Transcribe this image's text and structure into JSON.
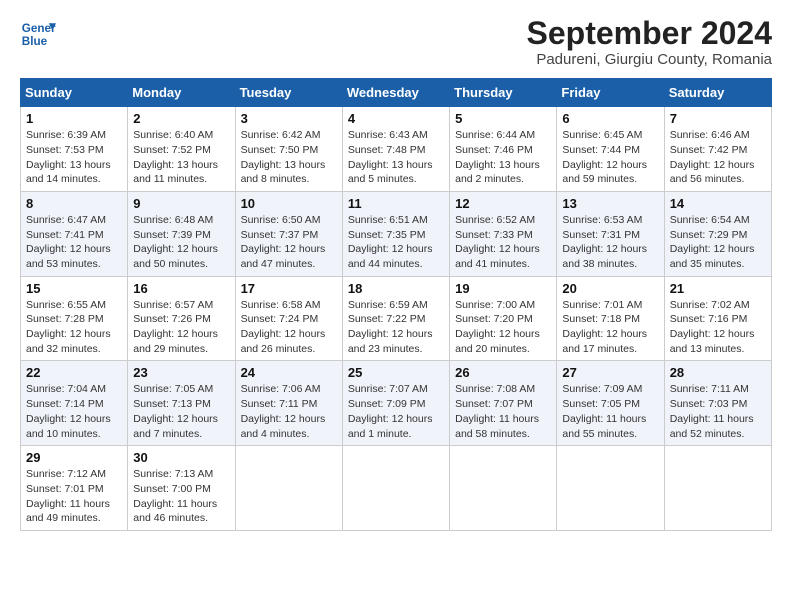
{
  "header": {
    "logo_line1": "General",
    "logo_line2": "Blue",
    "main_title": "September 2024",
    "subtitle": "Padureni, Giurgiu County, Romania"
  },
  "weekdays": [
    "Sunday",
    "Monday",
    "Tuesday",
    "Wednesday",
    "Thursday",
    "Friday",
    "Saturday"
  ],
  "weeks": [
    [
      {
        "day": "1",
        "sunrise": "6:39 AM",
        "sunset": "7:53 PM",
        "daylight": "13 hours and 14 minutes."
      },
      {
        "day": "2",
        "sunrise": "6:40 AM",
        "sunset": "7:52 PM",
        "daylight": "13 hours and 11 minutes."
      },
      {
        "day": "3",
        "sunrise": "6:42 AM",
        "sunset": "7:50 PM",
        "daylight": "13 hours and 8 minutes."
      },
      {
        "day": "4",
        "sunrise": "6:43 AM",
        "sunset": "7:48 PM",
        "daylight": "13 hours and 5 minutes."
      },
      {
        "day": "5",
        "sunrise": "6:44 AM",
        "sunset": "7:46 PM",
        "daylight": "13 hours and 2 minutes."
      },
      {
        "day": "6",
        "sunrise": "6:45 AM",
        "sunset": "7:44 PM",
        "daylight": "12 hours and 59 minutes."
      },
      {
        "day": "7",
        "sunrise": "6:46 AM",
        "sunset": "7:42 PM",
        "daylight": "12 hours and 56 minutes."
      }
    ],
    [
      {
        "day": "8",
        "sunrise": "6:47 AM",
        "sunset": "7:41 PM",
        "daylight": "12 hours and 53 minutes."
      },
      {
        "day": "9",
        "sunrise": "6:48 AM",
        "sunset": "7:39 PM",
        "daylight": "12 hours and 50 minutes."
      },
      {
        "day": "10",
        "sunrise": "6:50 AM",
        "sunset": "7:37 PM",
        "daylight": "12 hours and 47 minutes."
      },
      {
        "day": "11",
        "sunrise": "6:51 AM",
        "sunset": "7:35 PM",
        "daylight": "12 hours and 44 minutes."
      },
      {
        "day": "12",
        "sunrise": "6:52 AM",
        "sunset": "7:33 PM",
        "daylight": "12 hours and 41 minutes."
      },
      {
        "day": "13",
        "sunrise": "6:53 AM",
        "sunset": "7:31 PM",
        "daylight": "12 hours and 38 minutes."
      },
      {
        "day": "14",
        "sunrise": "6:54 AM",
        "sunset": "7:29 PM",
        "daylight": "12 hours and 35 minutes."
      }
    ],
    [
      {
        "day": "15",
        "sunrise": "6:55 AM",
        "sunset": "7:28 PM",
        "daylight": "12 hours and 32 minutes."
      },
      {
        "day": "16",
        "sunrise": "6:57 AM",
        "sunset": "7:26 PM",
        "daylight": "12 hours and 29 minutes."
      },
      {
        "day": "17",
        "sunrise": "6:58 AM",
        "sunset": "7:24 PM",
        "daylight": "12 hours and 26 minutes."
      },
      {
        "day": "18",
        "sunrise": "6:59 AM",
        "sunset": "7:22 PM",
        "daylight": "12 hours and 23 minutes."
      },
      {
        "day": "19",
        "sunrise": "7:00 AM",
        "sunset": "7:20 PM",
        "daylight": "12 hours and 20 minutes."
      },
      {
        "day": "20",
        "sunrise": "7:01 AM",
        "sunset": "7:18 PM",
        "daylight": "12 hours and 17 minutes."
      },
      {
        "day": "21",
        "sunrise": "7:02 AM",
        "sunset": "7:16 PM",
        "daylight": "12 hours and 13 minutes."
      }
    ],
    [
      {
        "day": "22",
        "sunrise": "7:04 AM",
        "sunset": "7:14 PM",
        "daylight": "12 hours and 10 minutes."
      },
      {
        "day": "23",
        "sunrise": "7:05 AM",
        "sunset": "7:13 PM",
        "daylight": "12 hours and 7 minutes."
      },
      {
        "day": "24",
        "sunrise": "7:06 AM",
        "sunset": "7:11 PM",
        "daylight": "12 hours and 4 minutes."
      },
      {
        "day": "25",
        "sunrise": "7:07 AM",
        "sunset": "7:09 PM",
        "daylight": "12 hours and 1 minute."
      },
      {
        "day": "26",
        "sunrise": "7:08 AM",
        "sunset": "7:07 PM",
        "daylight": "11 hours and 58 minutes."
      },
      {
        "day": "27",
        "sunrise": "7:09 AM",
        "sunset": "7:05 PM",
        "daylight": "11 hours and 55 minutes."
      },
      {
        "day": "28",
        "sunrise": "7:11 AM",
        "sunset": "7:03 PM",
        "daylight": "11 hours and 52 minutes."
      }
    ],
    [
      {
        "day": "29",
        "sunrise": "7:12 AM",
        "sunset": "7:01 PM",
        "daylight": "11 hours and 49 minutes."
      },
      {
        "day": "30",
        "sunrise": "7:13 AM",
        "sunset": "7:00 PM",
        "daylight": "11 hours and 46 minutes."
      },
      null,
      null,
      null,
      null,
      null
    ]
  ]
}
